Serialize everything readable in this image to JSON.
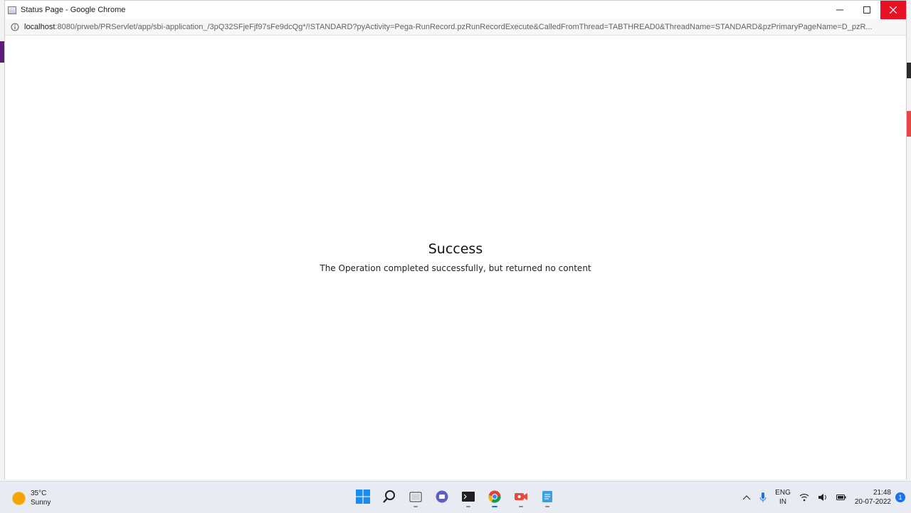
{
  "window": {
    "title": "Status Page - Google Chrome",
    "url_host": "localhost",
    "url_rest": ":8080/prweb/PRServlet/app/sbi-application_/3pQ32SFjeFjf97sFe9dcQg*/!STANDARD?pyActivity=Pega-RunRecord.pzRunRecordExecute&CalledFromThread=TABTHREAD0&ThreadName=STANDARD&pzPrimaryPageName=D_pzR..."
  },
  "content": {
    "heading": "Success",
    "message": "The Operation completed successfully, but returned no content"
  },
  "taskbar": {
    "weather_temp": "35°C",
    "weather_desc": "Sunny",
    "lang_line1": "ENG",
    "lang_line2": "IN",
    "time": "21:48",
    "date": "20-07-2022",
    "notification_count": "1"
  },
  "colors": {
    "close_button": "#e81123",
    "accent": "#1a73e8"
  }
}
